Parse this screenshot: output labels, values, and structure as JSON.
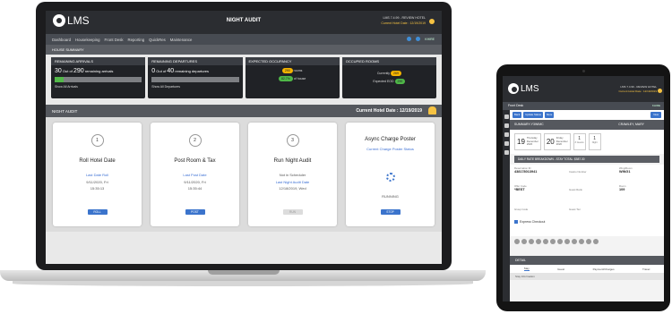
{
  "app": {
    "logo_text": "LMS",
    "page_title": "NIGHT AUDIT",
    "property_line": "LMS 7.4.99 - REVIEW HOTEL",
    "hotel_date_line": "Current Hotel Date : 12/19/2019"
  },
  "nav": {
    "items": [
      "Dashboard",
      "Housekeeping",
      "Front Desk",
      "Reporting",
      "QuickRes",
      "Maintenance"
    ],
    "user": "KHIRE"
  },
  "house_summary": {
    "title": "HOUSE SUMMARY",
    "arrivals": {
      "title": "REMAINING ARRIVALS",
      "count": "30",
      "total": "290",
      "text_out_of": "Out of",
      "text_suffix": "remaining arrivals",
      "fill_fraction": 0.1,
      "toggle": "Show All Arrivals"
    },
    "departures": {
      "title": "REMAINING DEPARTURES",
      "count": "0",
      "total": "40",
      "text_out_of": "Out of",
      "text_suffix": "remaining departures",
      "fill_fraction": 0,
      "toggle": "Show All Departures"
    },
    "occupancy": {
      "title": "EXPECTED OCCUPANCY",
      "rooms": "290",
      "rooms_label": "rooms",
      "percent": "82.7%",
      "percent_label": "of house"
    },
    "occupied": {
      "title": "OCCUPIED ROOMS",
      "currently_label": "Currently",
      "currently": "269",
      "expected_label": "Expected EOD",
      "expected": "290"
    }
  },
  "night_audit": {
    "title": "NIGHT AUDIT",
    "current_date": "Current Hotel Date : 12/19/2019",
    "steps": [
      {
        "num": "1",
        "title": "Roll Hotel Date",
        "link": "Last Date Roll",
        "line1": "9/11/2020, Fri",
        "line2": "15:35:13",
        "button": "ROLL"
      },
      {
        "num": "2",
        "title": "Post Room & Tax",
        "link": "Last Post Date",
        "line1": "9/11/2020, Fri",
        "line2": "15:35:44",
        "button": "POST"
      },
      {
        "num": "3",
        "title": "Run Night Audit",
        "link": "Last Night Audit Date",
        "line0": "Not in Scheduler",
        "line1": "12/18/2019, Wed",
        "button": "RUN"
      },
      {
        "title": "Async Charge Poster",
        "link": "Current Charge Poster Status",
        "line1": "RUNNING",
        "button": "STOP"
      }
    ]
  },
  "tablet": {
    "logo_text": "LMS",
    "property_line": "LMS 7.4.99 - REVIEW HOTEL",
    "hotel_date_line": "Current Hotel Date : 12/19/2019",
    "nav_title": "Front Desk",
    "user": "KHIRE",
    "toolbar": {
      "back": "Back",
      "update": "Update Status",
      "more": "More",
      "new": "New"
    },
    "summary_label": "SUMMARY-Y3WIMC",
    "guest_name": "CRAWLEY, MARY",
    "arrival": {
      "day": "19",
      "weekday": "Thursday",
      "month": "December",
      "year": "2020"
    },
    "departure": {
      "day": "20",
      "weekday": "Friday",
      "month": "December",
      "year": "2020"
    },
    "guests": "1",
    "guests_label": "# Guests",
    "nights": "1",
    "nights_label": "Night",
    "rate_bar": "DAILY RATE BREAKDOWN - STAY TOTAL: $587.30",
    "reservation_label": "Reservation ID",
    "reservation_id": "438178013941",
    "casino_label": "Casino Number",
    "wing_label": "Wing/Room",
    "wing_value": "WING1",
    "offer_label": "Offer Code",
    "offer_value": "*BEST",
    "guest_rank_label": "Guest Rank",
    "room_label": "Room",
    "room_value": "109",
    "group_label": "Group Code",
    "guest_tier_label": "Guest Tier",
    "express": "Express Checkout",
    "detail": "DETAIL",
    "tabs": [
      "Stay",
      "Guest",
      "Payment/Charges",
      "Travel"
    ],
    "stay_info": "Stay Information"
  }
}
